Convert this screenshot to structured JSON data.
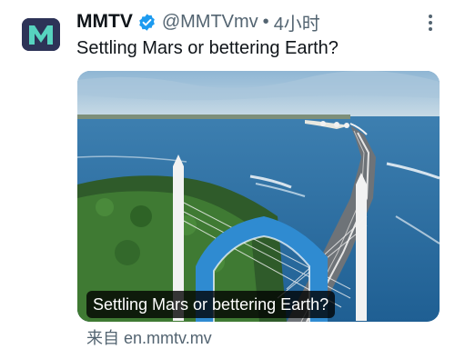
{
  "author": {
    "name": "MMTV",
    "handle": "@MMTVmv",
    "separator": "•",
    "time": "4小时",
    "verified_icon": "verified-badge-icon",
    "avatar_letter": "M",
    "avatar_bg": "#2d3357",
    "avatar_letter_color": "#57d3bf"
  },
  "tweet": {
    "text": "Settling Mars or bettering Earth?"
  },
  "card": {
    "caption": "Settling Mars or bettering Earth?",
    "source_prefix": "来自",
    "source_domain": "en.mmtv.mv",
    "image_description_icon": "bridge-photo"
  },
  "colors": {
    "verified_blue": "#1d9bf0",
    "muted_text": "#536471"
  }
}
